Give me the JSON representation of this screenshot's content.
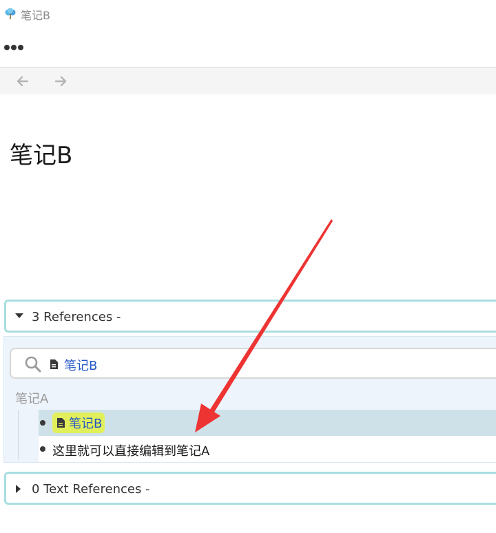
{
  "tab": {
    "title": "笔记B",
    "logo_icon": "tree-icon"
  },
  "toolbar": {
    "more_icon": "more-dots-icon"
  },
  "nav": {
    "back_icon": "arrow-left-icon",
    "forward_icon": "arrow-right-icon"
  },
  "page": {
    "title": "笔记B"
  },
  "references": {
    "header_label": "3 References -",
    "expanded": true,
    "filter": {
      "page_link": "笔记B"
    },
    "groups": [
      {
        "title": "笔记A",
        "blocks": [
          {
            "page_link": "笔记B"
          },
          {
            "text": "这里就可以直接编辑到笔记A"
          }
        ]
      }
    ]
  },
  "text_references": {
    "header_label": "0 Text References -",
    "expanded": false
  },
  "colors": {
    "accent_border": "#a9dde0",
    "link": "#2456c9",
    "tag_highlight": "#e1f05a",
    "row_highlight": "#cee1e9",
    "annotation_arrow": "#ee3333"
  }
}
